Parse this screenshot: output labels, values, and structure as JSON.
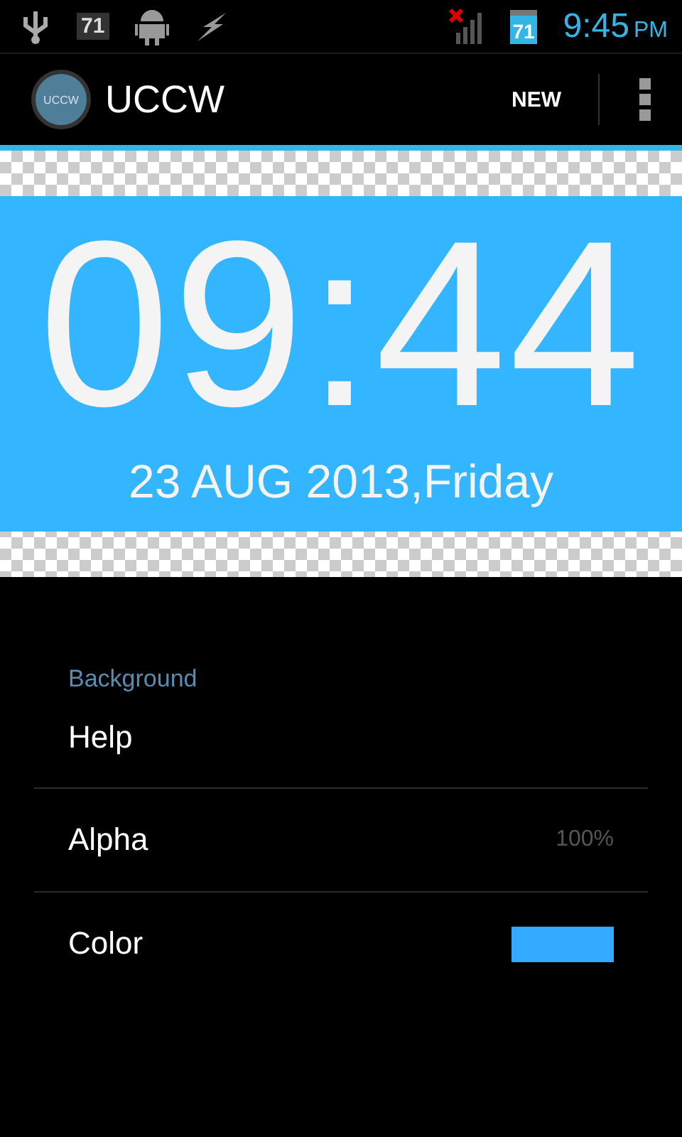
{
  "status_bar": {
    "notification_badge": "71",
    "calendar_badge": "71",
    "time": "9:45",
    "ampm": "PM"
  },
  "action_bar": {
    "logo_text": "UCCW",
    "title": "UCCW",
    "action": "NEW"
  },
  "widget": {
    "time": "09:44",
    "date": "23 AUG 2013,Friday"
  },
  "settings": {
    "category": "Background",
    "items": [
      {
        "kind": "plain",
        "label": "Help"
      },
      {
        "kind": "value",
        "label": "Alpha",
        "value": "100%"
      },
      {
        "kind": "color",
        "label": "Color",
        "color": "#33aaff"
      }
    ]
  }
}
